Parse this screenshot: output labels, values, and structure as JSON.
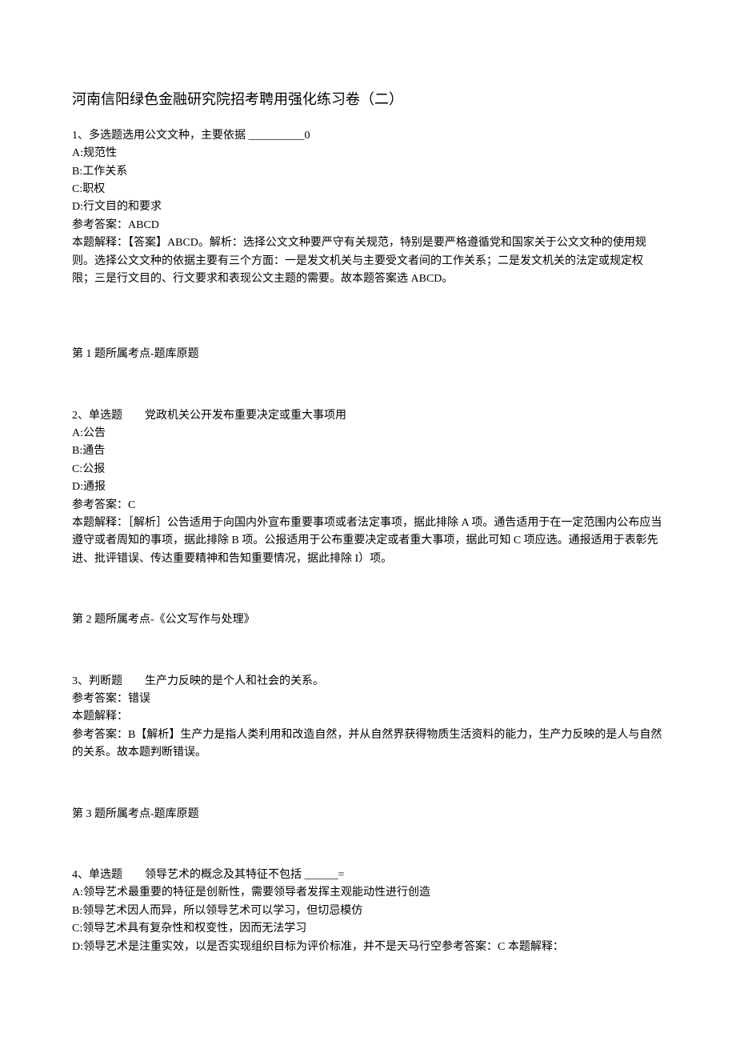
{
  "title": "河南信阳绿色金融研究院招考聘用强化练习卷（二）",
  "questions": [
    {
      "header": "1、多选题选用公文文种，主要依据 __________0",
      "options": [
        "A:规范性",
        "B:工作关系",
        "C:职权",
        "D:行文目的和要求"
      ],
      "answer": "参考答案：ABCD",
      "explanation": "本题解释：【答案】ABCD。解析：选择公文文种要严守有关规范，特别是要严格遵循党和国家关于公文文种的使用规则。选择公文文种的依据主要有三个方面：一是发文机关与主要受文者间的工作关系；二是发文机关的法定或规定权限；三是行文目的、行文要求和表现公文主题的需要。故本题答案选 ABCD。",
      "topic": "第 1 题所属考点-题库原题"
    },
    {
      "header": "2、单选题　　党政机关公开发布重要决定或重大事项用",
      "options": [
        "A:公告",
        "B:通告",
        "C:公报",
        "D:通报"
      ],
      "answer": "参考答案：C",
      "explanation": "本题解释：［解析］公告适用于向国内外宣布重要事项或者法定事项，据此排除 A 项。通告适用于在一定范围内公布应当遵守或者周知的事项，据此排除 B 项。公报适用于公布重要决定或者重大事项，据此可知 C 项应选。通报适用于表彰先进、批评错误、传达重要精神和告知重要情况，据此排除 I）项。",
      "topic": "第 2 题所属考点-《公文写作与处理》"
    },
    {
      "header": "3、判断题　　生产力反映的是个人和社会的关系。",
      "options": [],
      "answer": "参考答案：错误",
      "explanation_label": "本题解释：",
      "explanation": "参考答案：B【解析】生产力是指人类利用和改造自然，并从自然界获得物质生活资料的能力，生产力反映的是人与自然的关系。故本题判断错误。",
      "topic": "第 3 题所属考点-题库原题"
    },
    {
      "header": "4、单选题　　领导艺术的概念及其特征不包括 ______=",
      "options": [
        "A:领导艺术最重要的特征是创新性，需要领导者发挥主观能动性进行创造",
        "B:领导艺术因人而异，所以领导艺术可以学习，但切忌模仿",
        "C:领导艺术具有复杂性和权变性，因而无法学习",
        "D:领导艺术是注重实效，以是否实现组织目标为评价标准，并不是天马行空参考答案：C 本题解释："
      ],
      "answer": "",
      "explanation": "",
      "topic": ""
    }
  ]
}
